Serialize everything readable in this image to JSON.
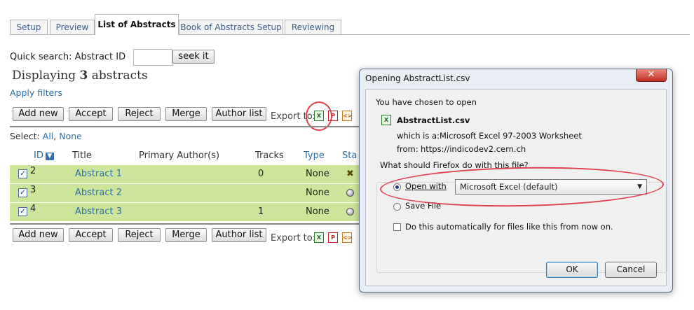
{
  "tabs": [
    {
      "label": "Setup"
    },
    {
      "label": "Preview"
    },
    {
      "label": "List of Abstracts",
      "active": true
    },
    {
      "label": "Book of Abstracts Setup"
    },
    {
      "label": "Reviewing"
    }
  ],
  "quick_search": {
    "label": "Quick search: Abstract ID",
    "value": "",
    "button": "seek it"
  },
  "display": {
    "prefix": "Displaying",
    "count": "3",
    "suffix": "abstracts"
  },
  "apply_filters": "Apply filters",
  "actions": {
    "add_new": "Add new",
    "accept": "Accept",
    "reject": "Reject",
    "merge": "Merge",
    "author_list": "Author list",
    "export_to": "Export to:"
  },
  "select": {
    "label": "Select:",
    "all": "All",
    "none": "None"
  },
  "columns": {
    "id": "ID",
    "title": "Title",
    "primary_authors": "Primary Author(s)",
    "tracks": "Tracks",
    "type": "Type",
    "status": "Sta"
  },
  "rows": [
    {
      "id": "2",
      "title": "Abstract 1",
      "author": "",
      "tracks": "0",
      "type": "None",
      "status_icon": "x-status-icon"
    },
    {
      "id": "3",
      "title": "Abstract 2",
      "author": "",
      "tracks": "",
      "type": "None",
      "status_icon": "circle-status-icon"
    },
    {
      "id": "4",
      "title": "Abstract 3",
      "author": "",
      "tracks": "1",
      "type": "None",
      "status_icon": "circle-status-icon"
    }
  ],
  "icons": {
    "excel": "excel-icon",
    "pdf": "pdf-icon",
    "xml": "xml-icon"
  },
  "colors": {
    "row_highlight": "#cce59a",
    "link": "#2e6fa7",
    "annotation": "#e04050"
  },
  "dialog": {
    "title": "Opening AbstractList.csv",
    "close": "✕",
    "intro": "You have chosen to open",
    "filename": "AbstractList.csv",
    "which_is_label": "which is a:",
    "which_is_value": "Microsoft Excel 97-2003 Worksheet",
    "from_label": "from:",
    "from_value": "https://indicodev2.cern.ch",
    "question": "What should Firefox do with this file?",
    "open_with_label": "Open with",
    "open_with_value": "Microsoft Excel (default)",
    "save_file_label": "Save File",
    "auto_label": "Do this automatically for files like this from now on.",
    "ok": "OK",
    "cancel": "Cancel"
  }
}
